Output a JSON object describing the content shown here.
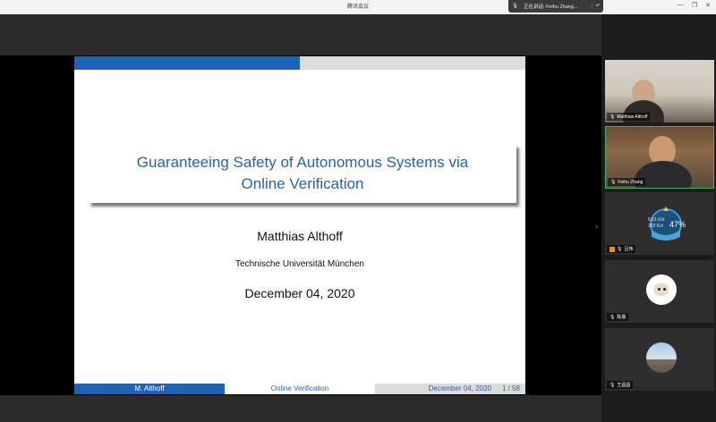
{
  "window": {
    "title": "腾讯会议"
  },
  "speaking_indicator": {
    "text": "正在讲话: Feihu Zhang..."
  },
  "slide": {
    "title_line1": "Guaranteeing Safety of Autonomous Systems via",
    "title_line2": "Online Verification",
    "author": "Matthias Althoff",
    "institution": "Technische Universität München",
    "date": "December 04, 2020",
    "footer": {
      "author": "M. Althoff",
      "short_title": "Online Verification",
      "date": "December 04, 2020",
      "page": "1 / 58"
    }
  },
  "participants": [
    {
      "name": "Matthias Althoff",
      "type": "video"
    },
    {
      "name": "Feihu Zhang",
      "type": "video",
      "active": true
    },
    {
      "name": "吕伟",
      "type": "widget",
      "gauge_percent": "47%",
      "up": "6.51 K/s",
      "down": "383 K/s"
    },
    {
      "name": "陈晨",
      "type": "avatar"
    },
    {
      "name": "王昌昌",
      "type": "avatar"
    }
  ],
  "colors": {
    "slide_blue": "#1b65b8",
    "title_blue": "#2a62a8",
    "active_border": "#3cb371"
  }
}
